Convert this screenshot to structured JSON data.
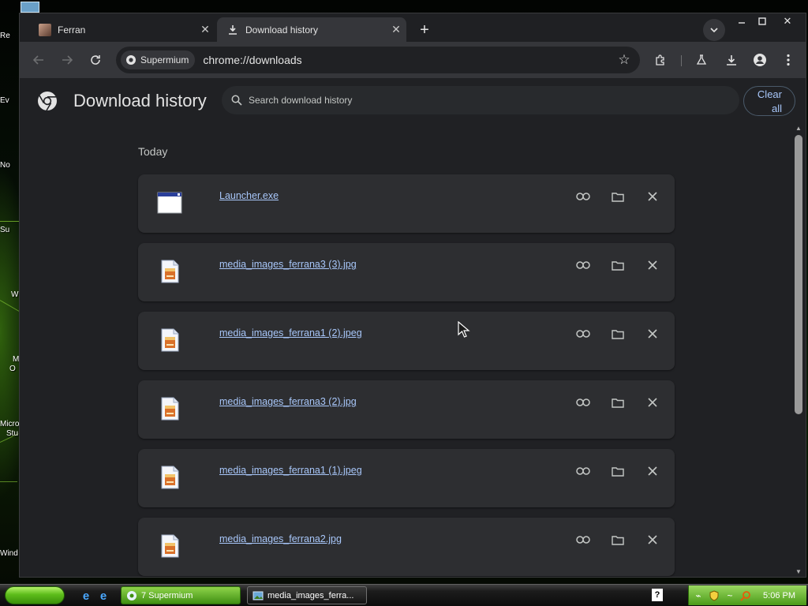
{
  "desktop": {
    "icon_labels": [
      "Re",
      "Ev",
      "No",
      "Su",
      "W",
      "M",
      "O",
      "Micro",
      "Stu",
      "Wind"
    ]
  },
  "tabs": [
    {
      "title": "Ferran",
      "active": false
    },
    {
      "title": "Download history",
      "active": true
    }
  ],
  "toolbar": {
    "site_chip": "Supermium",
    "url": "chrome://downloads"
  },
  "downloads_page": {
    "title": "Download history",
    "search_placeholder": "Search download history",
    "clear_all_label_line1": "Clear",
    "clear_all_label_line2": "all",
    "section_label": "Today",
    "items": [
      {
        "filename": "Launcher.exe",
        "icon": "exe-window-icon"
      },
      {
        "filename": "media_images_ferrana3 (3).jpg",
        "icon": "image-file-icon"
      },
      {
        "filename": "media_images_ferrana1 (2).jpeg",
        "icon": "image-file-icon"
      },
      {
        "filename": "media_images_ferrana3 (2).jpg",
        "icon": "image-file-icon"
      },
      {
        "filename": "media_images_ferrana1 (1).jpeg",
        "icon": "image-file-icon"
      },
      {
        "filename": "media_images_ferrana2.jpg",
        "icon": "image-file-icon"
      }
    ]
  },
  "taskbar": {
    "tasks": [
      {
        "label": "7 Supermium",
        "active": true
      },
      {
        "label": "media_images_ferra...",
        "active": false
      }
    ],
    "clock": "5:06 PM"
  },
  "colors": {
    "page_bg": "#202124",
    "card_bg": "#2d2e31",
    "link": "#a8c7fa",
    "taskbar_green": "#5dbd1a"
  }
}
